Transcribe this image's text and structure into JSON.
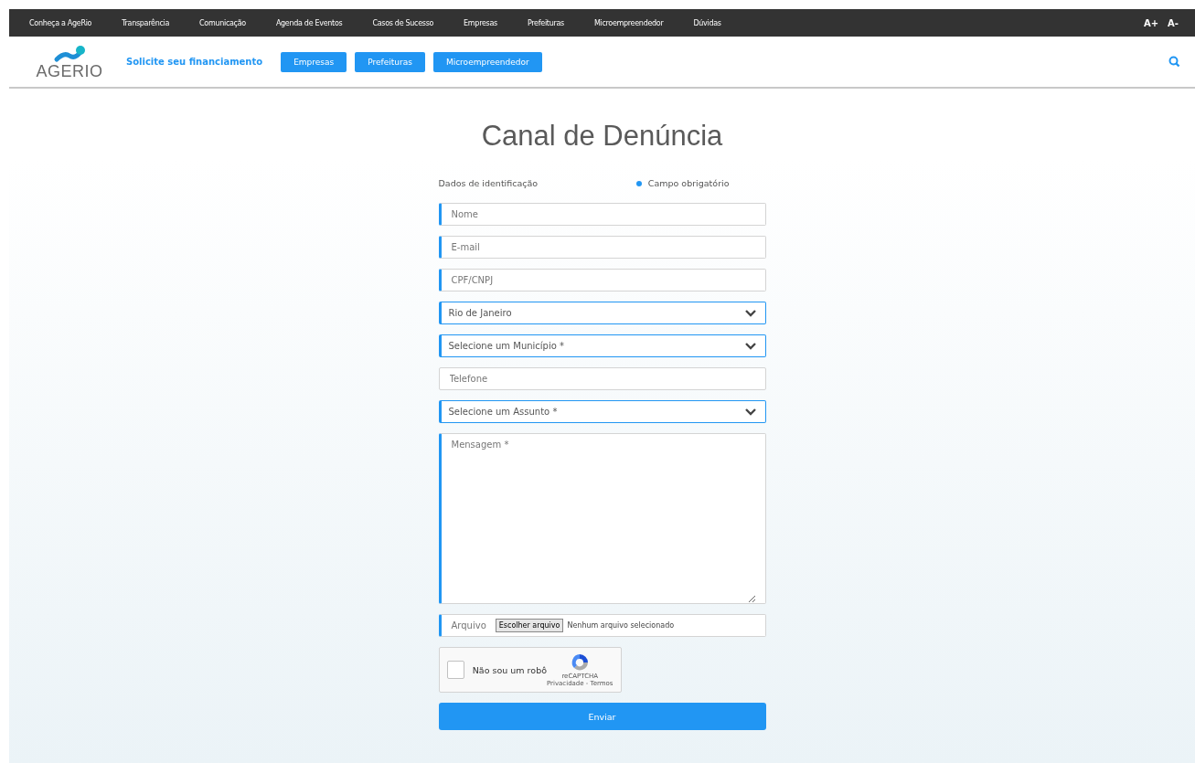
{
  "top_nav": {
    "links": [
      "Conheça a AgeRio",
      "Transparência",
      "Comunicação",
      "Agenda de Eventos",
      "Casos de Sucesso",
      "Empresas",
      "Prefeituras",
      "Microempreendedor",
      "Dúvidas"
    ],
    "font_controls": [
      "A+",
      "A-"
    ]
  },
  "header": {
    "logo": "AGERIO",
    "tagline": "Solicite seu financiamento",
    "buttons": [
      "Empresas",
      "Prefeituras",
      "Microempreendedor"
    ]
  },
  "form": {
    "title": "Canal de Denúncia",
    "section_label": "Dados de identificação",
    "required_legend": "Campo obrigatório",
    "fields": [
      {
        "kind": "text",
        "placeholder": "Nome",
        "required": true
      },
      {
        "kind": "text",
        "placeholder": "E-mail",
        "required": true
      },
      {
        "kind": "text",
        "placeholder": "CPF/CNPJ",
        "required": true
      },
      {
        "kind": "select",
        "value": "Rio de Janeiro",
        "required": true
      },
      {
        "kind": "select",
        "value": "Selecione um Município *",
        "required": true
      },
      {
        "kind": "text",
        "placeholder": "Telefone",
        "required": false
      },
      {
        "kind": "select",
        "value": "Selecione um Assunto *",
        "required": true
      },
      {
        "kind": "textarea",
        "placeholder": "Mensagem *",
        "required": true
      },
      {
        "kind": "file",
        "label": "Arquivo",
        "button": "Escolher arquivo",
        "status": "Nenhum arquivo selecionado",
        "required": true
      }
    ],
    "captcha": {
      "label": "Não sou um robô",
      "checked": false,
      "brand": "reCAPTCHA",
      "links": "Privacidade - Termos"
    },
    "submit": "Enviar"
  }
}
